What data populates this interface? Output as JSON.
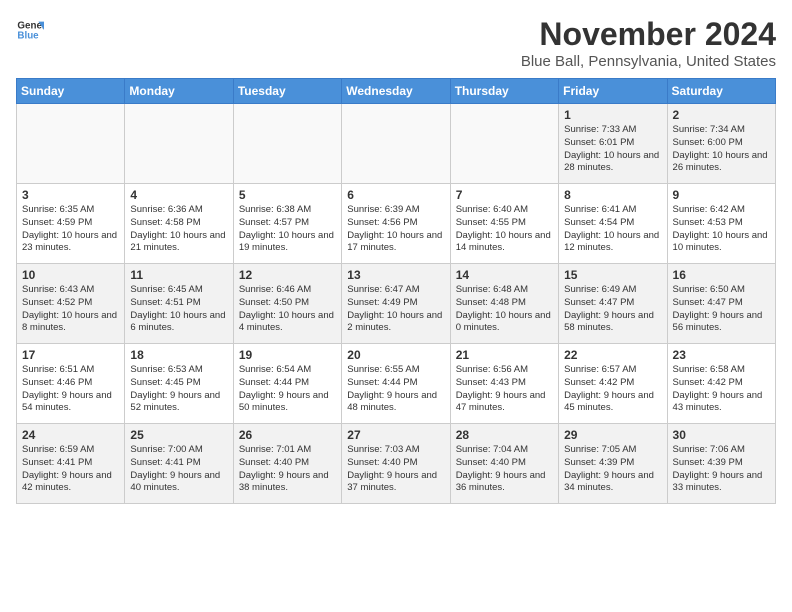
{
  "logo": {
    "line1": "General",
    "line2": "Blue"
  },
  "title": "November 2024",
  "location": "Blue Ball, Pennsylvania, United States",
  "days_of_week": [
    "Sunday",
    "Monday",
    "Tuesday",
    "Wednesday",
    "Thursday",
    "Friday",
    "Saturday"
  ],
  "weeks": [
    [
      {
        "day": "",
        "info": ""
      },
      {
        "day": "",
        "info": ""
      },
      {
        "day": "",
        "info": ""
      },
      {
        "day": "",
        "info": ""
      },
      {
        "day": "",
        "info": ""
      },
      {
        "day": "1",
        "info": "Sunrise: 7:33 AM\nSunset: 6:01 PM\nDaylight: 10 hours\nand 28 minutes."
      },
      {
        "day": "2",
        "info": "Sunrise: 7:34 AM\nSunset: 6:00 PM\nDaylight: 10 hours\nand 26 minutes."
      }
    ],
    [
      {
        "day": "3",
        "info": "Sunrise: 6:35 AM\nSunset: 4:59 PM\nDaylight: 10 hours\nand 23 minutes."
      },
      {
        "day": "4",
        "info": "Sunrise: 6:36 AM\nSunset: 4:58 PM\nDaylight: 10 hours\nand 21 minutes."
      },
      {
        "day": "5",
        "info": "Sunrise: 6:38 AM\nSunset: 4:57 PM\nDaylight: 10 hours\nand 19 minutes."
      },
      {
        "day": "6",
        "info": "Sunrise: 6:39 AM\nSunset: 4:56 PM\nDaylight: 10 hours\nand 17 minutes."
      },
      {
        "day": "7",
        "info": "Sunrise: 6:40 AM\nSunset: 4:55 PM\nDaylight: 10 hours\nand 14 minutes."
      },
      {
        "day": "8",
        "info": "Sunrise: 6:41 AM\nSunset: 4:54 PM\nDaylight: 10 hours\nand 12 minutes."
      },
      {
        "day": "9",
        "info": "Sunrise: 6:42 AM\nSunset: 4:53 PM\nDaylight: 10 hours\nand 10 minutes."
      }
    ],
    [
      {
        "day": "10",
        "info": "Sunrise: 6:43 AM\nSunset: 4:52 PM\nDaylight: 10 hours\nand 8 minutes."
      },
      {
        "day": "11",
        "info": "Sunrise: 6:45 AM\nSunset: 4:51 PM\nDaylight: 10 hours\nand 6 minutes."
      },
      {
        "day": "12",
        "info": "Sunrise: 6:46 AM\nSunset: 4:50 PM\nDaylight: 10 hours\nand 4 minutes."
      },
      {
        "day": "13",
        "info": "Sunrise: 6:47 AM\nSunset: 4:49 PM\nDaylight: 10 hours\nand 2 minutes."
      },
      {
        "day": "14",
        "info": "Sunrise: 6:48 AM\nSunset: 4:48 PM\nDaylight: 10 hours\nand 0 minutes."
      },
      {
        "day": "15",
        "info": "Sunrise: 6:49 AM\nSunset: 4:47 PM\nDaylight: 9 hours\nand 58 minutes."
      },
      {
        "day": "16",
        "info": "Sunrise: 6:50 AM\nSunset: 4:47 PM\nDaylight: 9 hours\nand 56 minutes."
      }
    ],
    [
      {
        "day": "17",
        "info": "Sunrise: 6:51 AM\nSunset: 4:46 PM\nDaylight: 9 hours\nand 54 minutes."
      },
      {
        "day": "18",
        "info": "Sunrise: 6:53 AM\nSunset: 4:45 PM\nDaylight: 9 hours\nand 52 minutes."
      },
      {
        "day": "19",
        "info": "Sunrise: 6:54 AM\nSunset: 4:44 PM\nDaylight: 9 hours\nand 50 minutes."
      },
      {
        "day": "20",
        "info": "Sunrise: 6:55 AM\nSunset: 4:44 PM\nDaylight: 9 hours\nand 48 minutes."
      },
      {
        "day": "21",
        "info": "Sunrise: 6:56 AM\nSunset: 4:43 PM\nDaylight: 9 hours\nand 47 minutes."
      },
      {
        "day": "22",
        "info": "Sunrise: 6:57 AM\nSunset: 4:42 PM\nDaylight: 9 hours\nand 45 minutes."
      },
      {
        "day": "23",
        "info": "Sunrise: 6:58 AM\nSunset: 4:42 PM\nDaylight: 9 hours\nand 43 minutes."
      }
    ],
    [
      {
        "day": "24",
        "info": "Sunrise: 6:59 AM\nSunset: 4:41 PM\nDaylight: 9 hours\nand 42 minutes."
      },
      {
        "day": "25",
        "info": "Sunrise: 7:00 AM\nSunset: 4:41 PM\nDaylight: 9 hours\nand 40 minutes."
      },
      {
        "day": "26",
        "info": "Sunrise: 7:01 AM\nSunset: 4:40 PM\nDaylight: 9 hours\nand 38 minutes."
      },
      {
        "day": "27",
        "info": "Sunrise: 7:03 AM\nSunset: 4:40 PM\nDaylight: 9 hours\nand 37 minutes."
      },
      {
        "day": "28",
        "info": "Sunrise: 7:04 AM\nSunset: 4:40 PM\nDaylight: 9 hours\nand 36 minutes."
      },
      {
        "day": "29",
        "info": "Sunrise: 7:05 AM\nSunset: 4:39 PM\nDaylight: 9 hours\nand 34 minutes."
      },
      {
        "day": "30",
        "info": "Sunrise: 7:06 AM\nSunset: 4:39 PM\nDaylight: 9 hours\nand 33 minutes."
      }
    ]
  ]
}
